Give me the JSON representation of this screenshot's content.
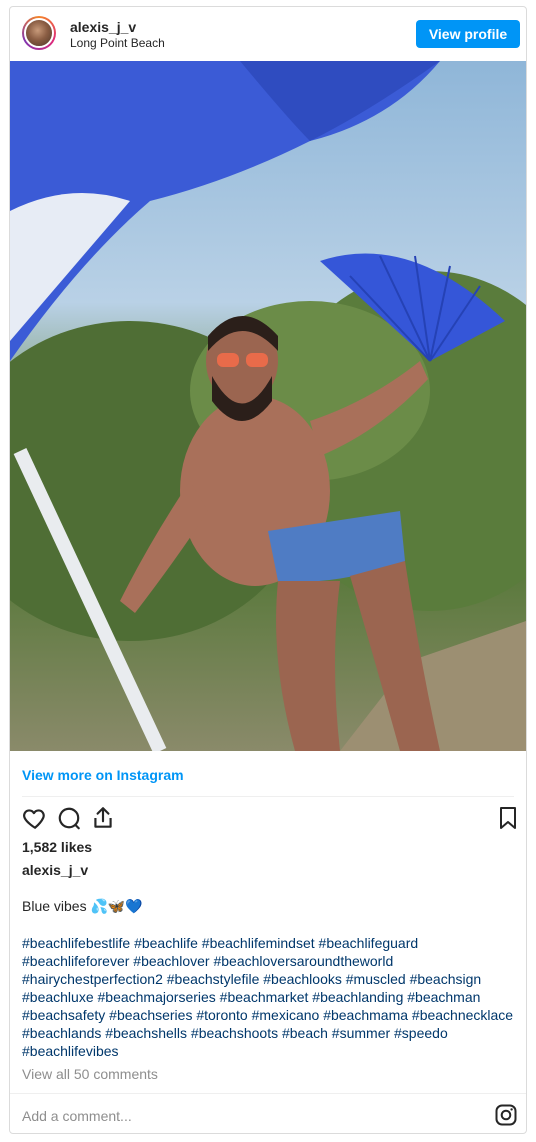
{
  "header": {
    "username": "alexis_j_v",
    "location": "Long Point Beach",
    "view_profile_label": "View profile"
  },
  "post": {
    "view_more_label": "View more on Instagram",
    "likes": "1,582 likes",
    "caption_username": "alexis_j_v",
    "caption_text": "Blue vibes 💦🦋💙",
    "hashtags": "#beachlifebestlife #beachlife #beachlifemindset #beachlifeguard #beachlifeforever #beachlover #beachloversaroundtheworld #hairychestperfection2 #beachstylefile #beachlooks #muscled #beachsign #beachluxe #beachmajorseries #beachmarket #beachlanding #beachman #beachsafety #beachseries #toronto #mexicano #beachmama #beachnecklace #beachlands #beachshells #beachshoots #beach #summer #speedo #beachlifevibes",
    "view_comments_label": "View all 50 comments",
    "comment_placeholder": "Add a comment..."
  },
  "icons": {
    "like": "heart-icon",
    "comment": "comment-bubble-icon",
    "share": "share-icon",
    "save": "bookmark-icon",
    "brand": "instagram-icon"
  },
  "colors": {
    "accent": "#0095f6",
    "hashtag": "#00376b",
    "muted": "#8e8e8e",
    "umbrella": "#3b5bd6"
  }
}
